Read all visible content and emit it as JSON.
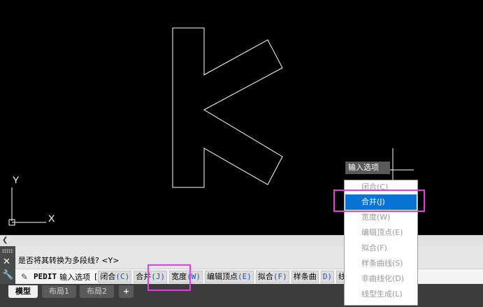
{
  "cursor_tooltip": "输入选项",
  "option_menu": {
    "items": [
      {
        "label": "闭合(C)",
        "selected": false
      },
      {
        "label": "合并(J)",
        "selected": true
      },
      {
        "label": "宽度(W)",
        "selected": false
      },
      {
        "label": "编辑顶点(E)",
        "selected": false
      },
      {
        "label": "拟合(F)",
        "selected": false
      },
      {
        "label": "样条曲线(S)",
        "selected": false
      },
      {
        "label": "非曲线化(D)",
        "selected": false
      },
      {
        "label": "线型生成(L)",
        "selected": false
      }
    ],
    "highlight_color": "#0a74d6"
  },
  "ucs": {
    "x_label": "X",
    "y_label": "Y"
  },
  "command_window": {
    "history_line": "是否将其转换为多段线? <Y>",
    "command_name": "PEDIT",
    "prompt": "输入选项",
    "bracket": "[",
    "options": [
      {
        "text": "闭合",
        "key": "(C)"
      },
      {
        "text": "合并",
        "key": "(J)"
      },
      {
        "text": "宽度",
        "key": "(W)"
      },
      {
        "text": "编辑顶点",
        "key": "(E)"
      },
      {
        "text": "拟合",
        "key": "(F)"
      },
      {
        "text": "样条曲",
        "key": ""
      },
      {
        "text": "",
        "key": "D)"
      },
      {
        "text": "线型生成",
        "key": "(L)"
      }
    ]
  },
  "tabs": [
    {
      "label": "模型",
      "active": true
    },
    {
      "label": "布局1",
      "active": false
    },
    {
      "label": "布局2",
      "active": false
    },
    {
      "label": "+",
      "active": false
    }
  ],
  "annotation_color": "#e040e0"
}
